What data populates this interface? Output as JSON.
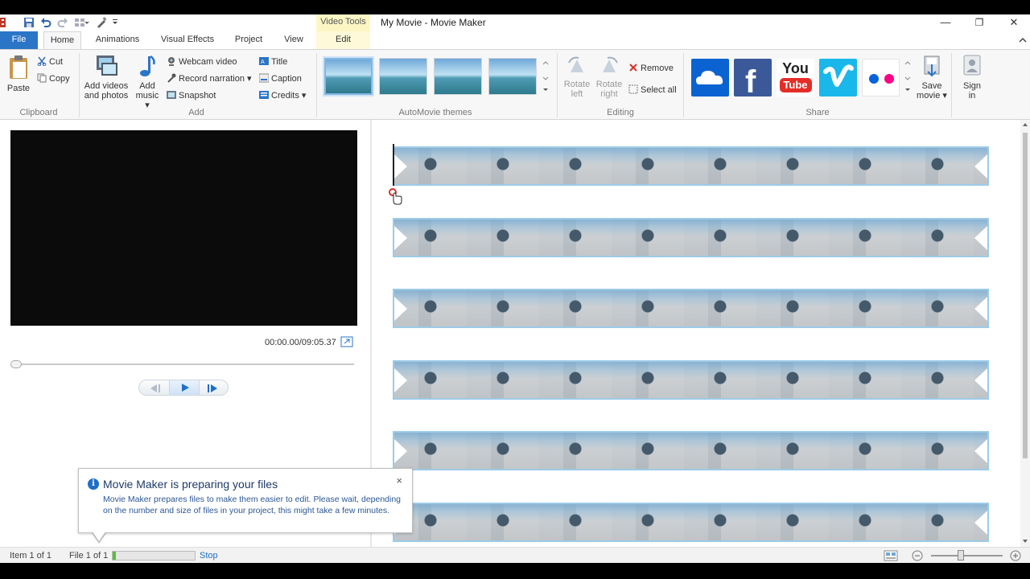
{
  "window": {
    "title": "My Movie - Movie Maker",
    "contextual_tab_group": "Video Tools",
    "controls": {
      "minimize": "—",
      "restore": "❐",
      "close": "✕"
    }
  },
  "tabs": [
    "File",
    "Home",
    "Animations",
    "Visual Effects",
    "Project",
    "View",
    "Edit"
  ],
  "ribbon": {
    "clipboard": {
      "label": "Clipboard",
      "paste": "Paste",
      "cut": "Cut",
      "copy": "Copy"
    },
    "add": {
      "label": "Add",
      "add_videos_line1": "Add videos",
      "add_videos_line2": "and photos",
      "add_music_line1": "Add",
      "add_music_line2": "music",
      "webcam": "Webcam video",
      "narration": "Record narration",
      "snapshot": "Snapshot",
      "title": "Title",
      "caption": "Caption",
      "credits": "Credits"
    },
    "automovie": {
      "label": "AutoMovie themes"
    },
    "editing": {
      "label": "Editing",
      "rotate_left_1": "Rotate",
      "rotate_left_2": "left",
      "rotate_right_1": "Rotate",
      "rotate_right_2": "right",
      "remove": "Remove",
      "select_all": "Select all"
    },
    "share": {
      "label": "Share",
      "save_movie_1": "Save",
      "save_movie_2": "movie",
      "sign_in_1": "Sign",
      "sign_in_2": "in",
      "youtube_text": "You"
    }
  },
  "preview": {
    "timecode": "00:00.00/09:05.37"
  },
  "storyboard": {
    "strip_count": 6
  },
  "notification": {
    "title": "Movie Maker is preparing your files",
    "body": "Movie Maker prepares files to make them easier to edit. Please wait, depending on the number and size of files in your project, this might take a few minutes.",
    "close": "×"
  },
  "status": {
    "item": "Item 1 of 1",
    "file": "File 1 of 1",
    "stop": "Stop",
    "progress": 0.04
  },
  "colors": {
    "file_tab": "#2b75c7",
    "accent": "#1e6fc8",
    "strip_border": "#9ccbe8"
  }
}
